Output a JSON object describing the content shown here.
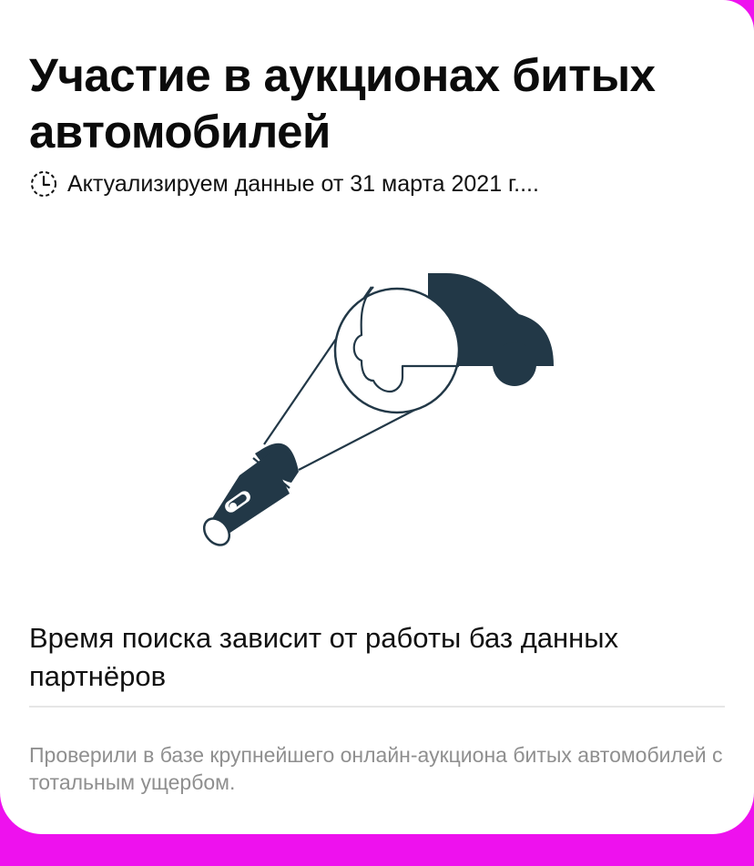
{
  "card": {
    "title": "Участие в аукционах битых автомобилей",
    "update_text": "Актуализируем данные от 31 марта 2021 г....",
    "update_icon": "clock-icon",
    "illustration_icon": "car-flashlight-illustration",
    "subtitle": "Время поиска зависит от работы баз данных партнёров",
    "note": "Проверили в базе крупнейшего онлайн-аукциона битых автомобилей с тотальным ущербом."
  },
  "colors": {
    "background": "#ee11ee",
    "card": "#ffffff",
    "illustration": "#223847",
    "muted_text": "#8f8f8f"
  }
}
